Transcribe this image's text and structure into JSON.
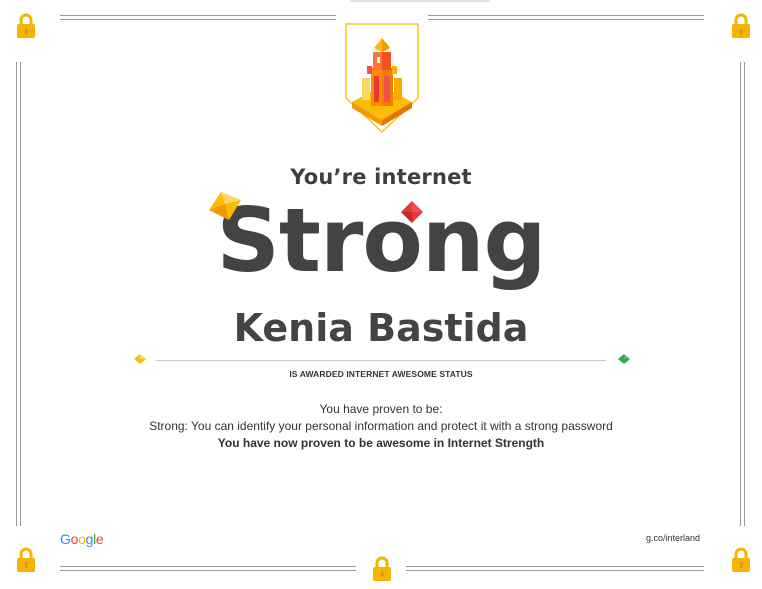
{
  "certificate": {
    "heading_small": "You’re internet",
    "heading_big": "Strong",
    "recipient_name": "Kenia Bastida",
    "awarded_line": "IS AWARDED INTERNET AWESOME STATUS",
    "proven_intro": "You have proven to be:",
    "proven_detail": "Strong: You can identify your personal information and protect it with a strong password",
    "proven_summary": "You have now proven to be awesome in Internet Strength"
  },
  "footer": {
    "brand_letters": [
      {
        "char": "G",
        "color": "#4285F4"
      },
      {
        "char": "o",
        "color": "#EA4335"
      },
      {
        "char": "o",
        "color": "#FBBC05"
      },
      {
        "char": "g",
        "color": "#4285F4"
      },
      {
        "char": "l",
        "color": "#34A853"
      },
      {
        "char": "e",
        "color": "#EA4335"
      }
    ],
    "url": "g.co/interland"
  },
  "icons": {
    "corner": "padlock-icon",
    "emblem": "tower-emblem-icon",
    "gems": [
      "yellow-gem-icon",
      "red-gem-icon",
      "yellow-diamond-icon",
      "green-diamond-icon"
    ]
  },
  "colors": {
    "text_dark": "#434343",
    "lock_gold": "#F4B400",
    "emblem_orange": "#F57C00",
    "emblem_red": "#E53935",
    "gem_green": "#34A853"
  }
}
